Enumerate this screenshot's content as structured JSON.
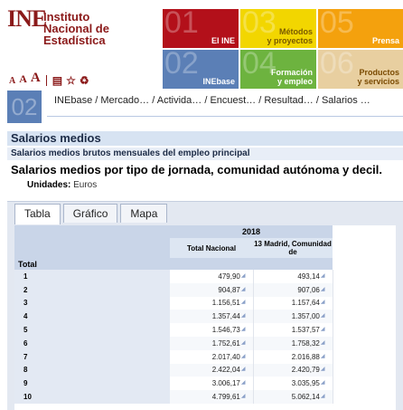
{
  "header": {
    "logo_letters": "INE",
    "institute_lines": [
      "Instituto",
      "Nacional de",
      "Estadística"
    ],
    "font_tools": [
      "A",
      "A",
      "A"
    ],
    "tiles": [
      {
        "num": "01",
        "label": "El INE",
        "color": "#b3101a"
      },
      {
        "num": "03",
        "label": "Métodos\ny proyectos",
        "color": "#f2d600"
      },
      {
        "num": "05",
        "label": "Prensa",
        "color": "#f4a10d"
      },
      {
        "num": "02",
        "label": "INEbase",
        "color": "#5b7fb6"
      },
      {
        "num": "04",
        "label": "Formación\ny empleo",
        "color": "#6db33f"
      },
      {
        "num": "06",
        "label": "Productos\ny servicios",
        "color": "#e8cfa0"
      }
    ]
  },
  "breadcrumb": {
    "num": "02",
    "items": [
      "INEbase",
      "Mercado…",
      "Activida…",
      "Encuest…",
      "Resultad…",
      "Salarios …"
    ]
  },
  "section_title": "Salarios medios",
  "subtitle": "Salarios medios brutos mensuales del empleo principal",
  "main_title": "Salarios medios por tipo de jornada, comunidad autónoma y decil.",
  "units": {
    "label": "Unidades:",
    "value": "Euros"
  },
  "tabs": [
    "Tabla",
    "Gráfico",
    "Mapa"
  ],
  "table": {
    "year": "2018",
    "columns": [
      "Total Nacional",
      "13 Madrid, Comunidad de"
    ],
    "group_label": "Total",
    "rows": [
      {
        "label": "1",
        "values": [
          "479,90",
          "493,14"
        ]
      },
      {
        "label": "2",
        "values": [
          "904,87",
          "907,06"
        ]
      },
      {
        "label": "3",
        "values": [
          "1.156,51",
          "1.157,64"
        ]
      },
      {
        "label": "4",
        "values": [
          "1.357,44",
          "1.357,00"
        ]
      },
      {
        "label": "5",
        "values": [
          "1.546,73",
          "1.537,57"
        ]
      },
      {
        "label": "6",
        "values": [
          "1.752,61",
          "1.758,32"
        ]
      },
      {
        "label": "7",
        "values": [
          "2.017,40",
          "2.016,88"
        ]
      },
      {
        "label": "8",
        "values": [
          "2.422,04",
          "2.420,79"
        ]
      },
      {
        "label": "9",
        "values": [
          "3.006,17",
          "3.035,95"
        ]
      },
      {
        "label": "10",
        "values": [
          "4.799,61",
          "5.062,14"
        ]
      }
    ]
  }
}
